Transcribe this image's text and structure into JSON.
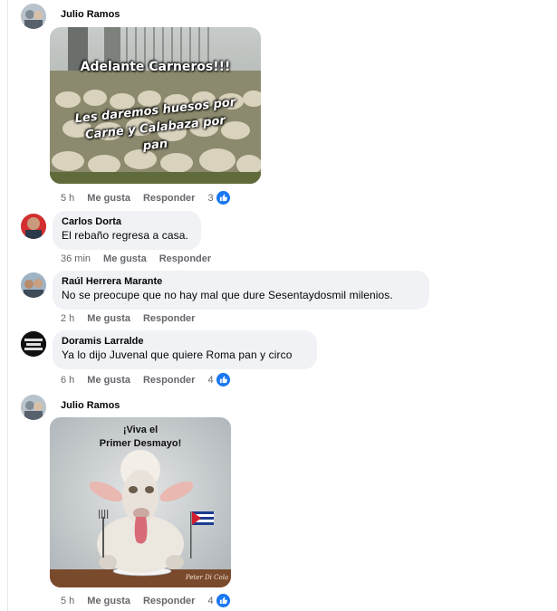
{
  "comments": [
    {
      "author": "Julio Ramos",
      "meme_line1": "Adelante Carneros!!!",
      "meme_line2": "Les daremos huesos por",
      "meme_line3": "Carne y Calabaza por",
      "meme_line4": "pan",
      "time": "5 h",
      "like": "Me gusta",
      "reply": "Responder",
      "reactions": "3"
    },
    {
      "author": "Carlos Dorta",
      "text": "El rebaño regresa a casa.",
      "time": "36 min",
      "like": "Me gusta",
      "reply": "Responder"
    },
    {
      "author": "Raúl Herrera Marante",
      "text": "No se preocupe que no hay mal que dure Sesentaydosmil milenios.",
      "time": "2 h",
      "like": "Me gusta",
      "reply": "Responder"
    },
    {
      "author": "Doramis Larralde",
      "avatar_text": "NO ME GUSTA LA DICTADURA",
      "text": "Ya lo dijo Juvenal que quiere Roma pan y circo",
      "time": "6 h",
      "like": "Me gusta",
      "reply": "Responder",
      "reactions": "4"
    },
    {
      "author": "Julio Ramos",
      "meme_line1": "¡Viva el",
      "meme_line2": "Primer Desmayo!",
      "signature": "Peter Di Cola",
      "time": "5 h",
      "like": "Me gusta",
      "reply": "Responder",
      "reactions": "4"
    }
  ],
  "colors": {
    "like_blue": "#1877f2",
    "bubble": "#f0f2f5",
    "meta_gray": "#65676b"
  },
  "icons": {
    "reaction": "thumbs-up-icon"
  }
}
